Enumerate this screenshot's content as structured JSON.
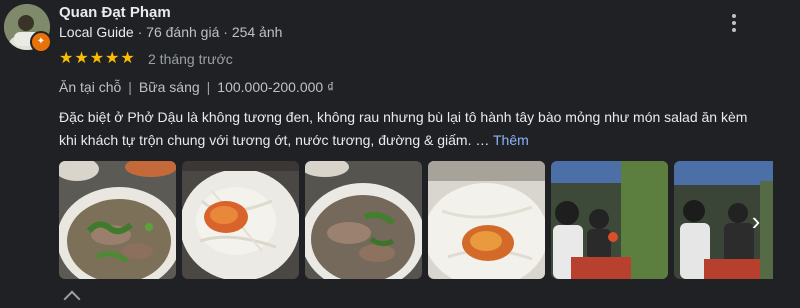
{
  "reviewer": {
    "name": "Quan Đạt Phạm",
    "badge": "Local Guide",
    "reviews_count": "76 đánh giá",
    "photos_count": "254 ảnh"
  },
  "rating": {
    "stars": 5,
    "max": 5,
    "time": "2 tháng trước"
  },
  "tags": {
    "meal_type": "Ăn tại chỗ",
    "meal": "Bữa sáng",
    "price": "100.000-200.000 ₫"
  },
  "review": {
    "text": "Đặc biệt ở Phở Dậu là không tương đen, không rau nhưng bù lại tô hành tây bào mỏng như món salad ăn kèm khi khách tự trộn chung với tương ớt, nước tương, đường & giấm. …",
    "more_label": "Thêm"
  },
  "photos": [
    {
      "subject": "phở bò với rau thơm"
    },
    {
      "subject": "hành tây bào với tương ớt"
    },
    {
      "subject": "phở bò với rau thơm"
    },
    {
      "subject": "hành tây bào với tương ớt"
    },
    {
      "subject": "khách ngồi ăn trong quán"
    },
    {
      "subject": "khách ngồi ăn trong quán"
    }
  ],
  "icons": {
    "menu": "more-vert-icon",
    "next": "chevron-right-icon",
    "star": "star-icon"
  },
  "colors": {
    "star": "#fbbc04",
    "link": "#8ab4f8",
    "background": "#202124"
  }
}
